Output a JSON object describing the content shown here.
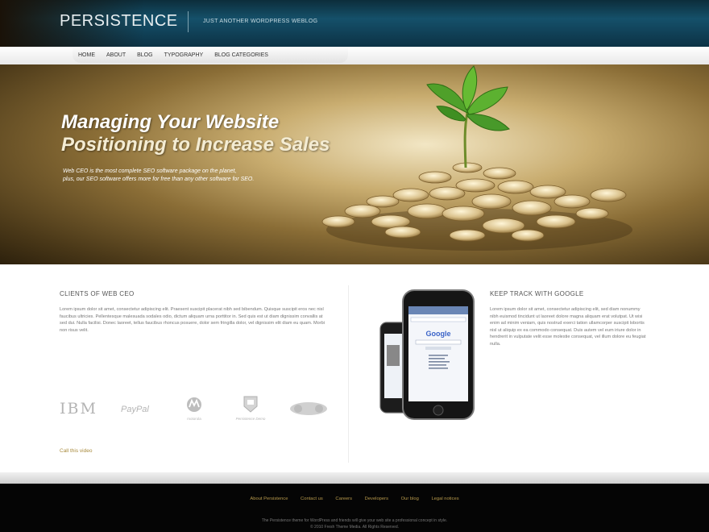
{
  "header": {
    "logo": "PERSISTENCE",
    "tagline": "JUST ANOTHER WORDPRESS WEBLOG"
  },
  "nav": {
    "items": [
      "HOME",
      "ABOUT",
      "BLOG",
      "TYPOGRAPHY",
      "BLOG CATEGORIES"
    ]
  },
  "hero": {
    "title_line1": "Managing Your Website",
    "title_line2": "Positioning to Increase Sales",
    "subtitle_line1": "Web CEO is the most complete SEO software package on the planet,",
    "subtitle_line2": "plus, our SEO software offers more for free than any other software for SEO."
  },
  "clients": {
    "title": "CLIENTS OF WEB CEO",
    "text": "Lorem ipsum dolor sit amet, consectetur adipiscing elit. Praesent suscipit placerat nibh sed bibendum. Quisque suscipit eros nec nisl faucibus ultricies. Pellentesque malesuada sodales odio, dictum aliquam urna porttitor in. Sed quis est ut diam dignissim convallis at sed dui. Nulla facilisi. Donec laoreet, tellus faucibus rhoncus posuere, dolor sem fringilla dolor, vel dignissim elit diam eu quam. Morbi non risus velit.",
    "partners": [
      "IBM",
      "PayPal",
      "motorola",
      "Persistence Demo",
      "Partner"
    ],
    "more_link": "Call this video"
  },
  "google": {
    "title": "KEEP TRACK WITH GOOGLE",
    "text": "Lorem ipsum dolor sit amet, consectetur adipiscing elit, sed diam nonummy nibh euismod tincidunt ut laoreet dolore magna aliquam erat volutpat. Ut wisi enim ad minim veniam, quis nostrud exerci tation ullamcorper suscipit lobortis nisl ut aliquip ex ea commodo consequat. Duis autem vel eum iriure dolor in hendrerit in vulputate velit esse molestie consequat, vel illum dolore eu feugiat nulla."
  },
  "footer": {
    "links": [
      "About Persistence",
      "Contact us",
      "Careers",
      "Developers",
      "Our blog",
      "Legal notices"
    ],
    "line1": "The Persistence theme for WordPress and friends will give your web site a professional concept in style.",
    "line2": "© 2010 Fresh Theme Media. All Rights Reserved."
  },
  "colors": {
    "header_bg": "#15506a",
    "hero_gold": "#c9ad70",
    "link_gold": "#b89a4c",
    "footer_bg": "#050505"
  }
}
